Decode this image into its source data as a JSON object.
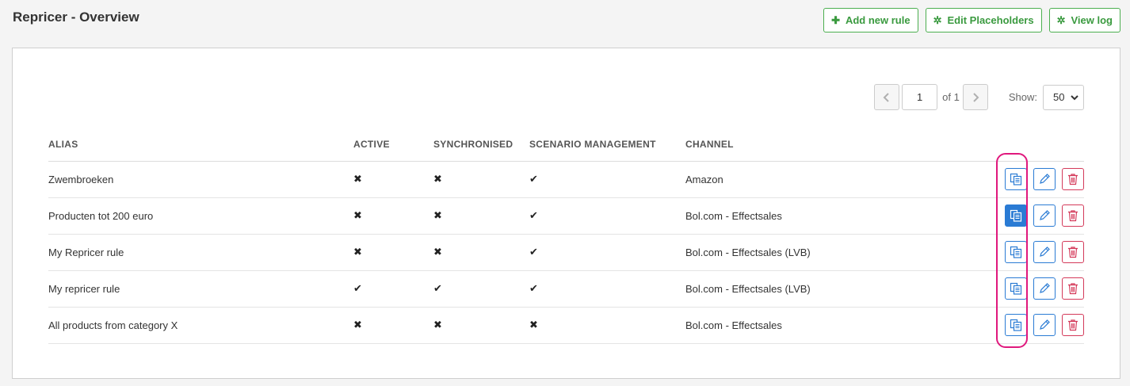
{
  "header": {
    "title": "Repricer - Overview",
    "buttons": {
      "add_rule": "Add new rule",
      "edit_placeholders": "Edit Placeholders",
      "view_log": "View log"
    }
  },
  "pagination": {
    "current_page": "1",
    "of_label": "of 1",
    "show_label": "Show:",
    "page_size": "50"
  },
  "table": {
    "columns": [
      "ALIAS",
      "ACTIVE",
      "SYNCHRONISED",
      "SCENARIO MANAGEMENT",
      "CHANNEL"
    ],
    "rows": [
      {
        "alias": "Zwembroeken",
        "active": "✖",
        "synchronised": "✖",
        "scenario": "✔",
        "channel": "Amazon"
      },
      {
        "alias": "Producten tot 200 euro",
        "active": "✖",
        "synchronised": "✖",
        "scenario": "✔",
        "channel": "Bol.com - Effectsales"
      },
      {
        "alias": "My Repricer rule",
        "active": "✖",
        "synchronised": "✖",
        "scenario": "✔",
        "channel": "Bol.com - Effectsales (LVB)"
      },
      {
        "alias": "My repricer rule",
        "active": "✔",
        "synchronised": "✔",
        "scenario": "✔",
        "channel": "Bol.com - Effectsales (LVB)"
      },
      {
        "alias": "All products from category X",
        "active": "✖",
        "synchronised": "✖",
        "scenario": "✖",
        "channel": "Bol.com - Effectsales"
      }
    ]
  },
  "icons": {
    "plus": "plus-icon",
    "gear": "gear-icon",
    "copy": "copy-icon",
    "edit": "pencil-icon",
    "delete": "trash-icon"
  },
  "colors": {
    "green": "#4caf50",
    "blue": "#2a7bd4",
    "red": "#d43a5a",
    "highlight": "#e0187d"
  }
}
